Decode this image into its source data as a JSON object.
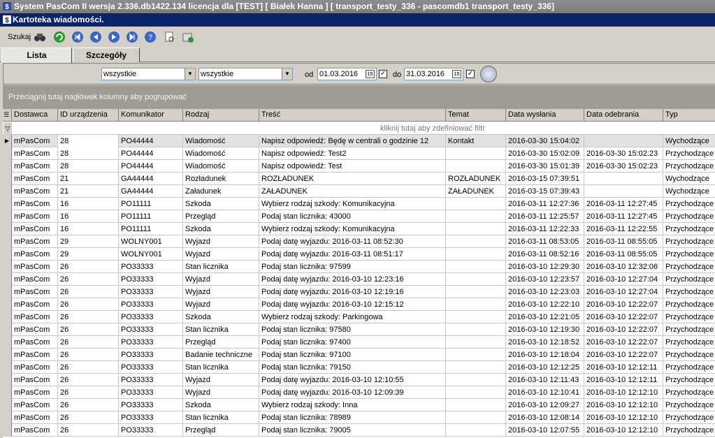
{
  "window": {
    "title": "System PasCom II wersja 2.336.db1422.134 licencja dla [TEST] [ Białek Hanna ] [ transport_testy_336 - pascomdb1 transport_testy_336]",
    "subtitle": "Kartoteka wiadomości."
  },
  "toolbar": {
    "search_label": "Szukaj",
    "buttons": [
      "binoculars-icon",
      "refresh-icon",
      "first-icon",
      "prev-icon",
      "next-icon",
      "last-icon",
      "help-icon",
      "preview-icon",
      "export-icon"
    ]
  },
  "tabs": [
    {
      "label": "Lista",
      "active": true
    },
    {
      "label": "Szczegóły",
      "active": false
    }
  ],
  "filters": {
    "select1": "wszystkie",
    "select2": "wszystkie",
    "from_label": "od",
    "from_date": "01.03.2016",
    "to_label": "do",
    "to_date": "31.03.2016",
    "cal_text": "15",
    "from_checked": true,
    "to_checked": true
  },
  "grid": {
    "group_hint": "Przeciągnij tutaj nagłówek kolumny aby pogrupować",
    "filter_hint": "kliknij tutaj aby zdefiniować filtr",
    "columns": [
      "Dostawca",
      "ID urządzenia",
      "Komunikator",
      "Rodzaj",
      "Treść",
      "Temat",
      "Data wysłania",
      "Data odebrania",
      "Typ"
    ],
    "rows": [
      [
        "mPasCom",
        "28",
        "PO44444",
        "Wiadomość",
        "Napisz odpowiedź: Będę w centrali o godzinie 12",
        "Kontakt",
        "2016-03-30 15:04:02",
        "",
        "Wychodzące"
      ],
      [
        "mPasCom",
        "28",
        "PO44444",
        "Wiadomość",
        "Napisz odpowiedź: Test2",
        "",
        "2016-03-30 15:02:09",
        "2016-03-30 15:02:23",
        "Przychodzące"
      ],
      [
        "mPasCom",
        "28",
        "PO44444",
        "Wiadomość",
        "Napisz odpowiedź: Test",
        "",
        "2016-03-30 15:01:39",
        "2016-03-30 15:02:23",
        "Przychodzące"
      ],
      [
        "mPasCom",
        "21",
        "GA44444",
        "Rozładunek",
        "ROZŁADUNEK",
        "ROZŁADUNEK",
        "2016-03-15 07:39:51",
        "",
        "Wychodzące"
      ],
      [
        "mPasCom",
        "21",
        "GA44444",
        "Załadunek",
        "ZAŁADUNEK",
        "ZAŁADUNEK",
        "2016-03-15 07:39:43",
        "",
        "Wychodzące"
      ],
      [
        "mPasCom",
        "16",
        "PO11111",
        "Szkoda",
        "Wybierz rodzaj szkody: Komunikacyjna",
        "",
        "2016-03-11 12:27:36",
        "2016-03-11 12:27:45",
        "Przychodzące"
      ],
      [
        "mPasCom",
        "16",
        "PO11111",
        "Przegląd",
        "Podaj stan licznika: 43000",
        "",
        "2016-03-11 12:25:57",
        "2016-03-11 12:27:45",
        "Przychodzące"
      ],
      [
        "mPasCom",
        "16",
        "PO11111",
        "Szkoda",
        "Wybierz rodzaj szkody: Komunikacyjna",
        "",
        "2016-03-11 12:22:33",
        "2016-03-11 12:22:55",
        "Przychodzące"
      ],
      [
        "mPasCom",
        "29",
        "WOLNY001",
        "Wyjazd",
        "Podaj datę wyjazdu: 2016-03-11 08:52:30",
        "",
        "2016-03-11 08:53:05",
        "2016-03-11 08:55:05",
        "Przychodzące"
      ],
      [
        "mPasCom",
        "29",
        "WOLNY001",
        "Wyjazd",
        "Podaj datę wyjazdu: 2016-03-11 08:51:17",
        "",
        "2016-03-11 08:52:16",
        "2016-03-11 08:55:05",
        "Przychodzące"
      ],
      [
        "mPasCom",
        "26",
        "PO33333",
        "Stan licznika",
        "Podaj stan licznika: 97599",
        "",
        "2016-03-10 12:29:30",
        "2016-03-10 12:32:06",
        "Przychodzące"
      ],
      [
        "mPasCom",
        "26",
        "PO33333",
        "Wyjazd",
        "Podaj datę wyjazdu: 2016-03-10 12:23:16",
        "",
        "2016-03-10 12:23:57",
        "2016-03-10 12:27:04",
        "Przychodzące"
      ],
      [
        "mPasCom",
        "26",
        "PO33333",
        "Wyjazd",
        "Podaj datę wyjazdu: 2016-03-10 12:19:16",
        "",
        "2016-03-10 12:23:03",
        "2016-03-10 12:27:04",
        "Przychodzące"
      ],
      [
        "mPasCom",
        "26",
        "PO33333",
        "Wyjazd",
        "Podaj datę wyjazdu: 2016-03-10 12:15:12",
        "",
        "2016-03-10 12:22:10",
        "2016-03-10 12:22:07",
        "Przychodzące"
      ],
      [
        "mPasCom",
        "26",
        "PO33333",
        "Szkoda",
        "Wybierz rodzaj szkody: Parkingowa",
        "",
        "2016-03-10 12:21:05",
        "2016-03-10 12:22:07",
        "Przychodzące"
      ],
      [
        "mPasCom",
        "26",
        "PO33333",
        "Stan licznika",
        "Podaj stan licznika: 97580",
        "",
        "2016-03-10 12:19:30",
        "2016-03-10 12:22:07",
        "Przychodzące"
      ],
      [
        "mPasCom",
        "26",
        "PO33333",
        "Przegląd",
        "Podaj stan licznika: 97400",
        "",
        "2016-03-10 12:18:52",
        "2016-03-10 12:22:07",
        "Przychodzące"
      ],
      [
        "mPasCom",
        "26",
        "PO33333",
        "Badanie techniczne",
        "Podaj stan licznika: 97100",
        "",
        "2016-03-10 12:18:04",
        "2016-03-10 12:22:07",
        "Przychodzące"
      ],
      [
        "mPasCom",
        "26",
        "PO33333",
        "Stan licznika",
        "Podaj stan licznika: 79150",
        "",
        "2016-03-10 12:12:25",
        "2016-03-10 12:12:11",
        "Przychodzące"
      ],
      [
        "mPasCom",
        "26",
        "PO33333",
        "Wyjazd",
        "Podaj datę wyjazdu: 2016-03-10 12:10:55",
        "",
        "2016-03-10 12:11:43",
        "2016-03-10 12:12:11",
        "Przychodzące"
      ],
      [
        "mPasCom",
        "26",
        "PO33333",
        "Wyjazd",
        "Podaj datę wyjazdu: 2016-03-10 12:09:39",
        "",
        "2016-03-10 12:10:41",
        "2016-03-10 12:12:10",
        "Przychodzące"
      ],
      [
        "mPasCom",
        "26",
        "PO33333",
        "Szkoda",
        "Wybierz rodzaj szkody: Inna",
        "",
        "2016-03-10 12:09:27",
        "2016-03-10 12:12:10",
        "Przychodzące"
      ],
      [
        "mPasCom",
        "26",
        "PO33333",
        "Stan licznika",
        "Podaj stan licznika: 78989",
        "",
        "2016-03-10 12:08:14",
        "2016-03-10 12:12:10",
        "Przychodzące"
      ],
      [
        "mPasCom",
        "26",
        "PO33333",
        "Przegląd",
        "Podaj stan licznika: 79005",
        "",
        "2016-03-10 12:07:55",
        "2016-03-10 12:12:10",
        "Przychodzące"
      ]
    ],
    "selected_row": 0
  }
}
